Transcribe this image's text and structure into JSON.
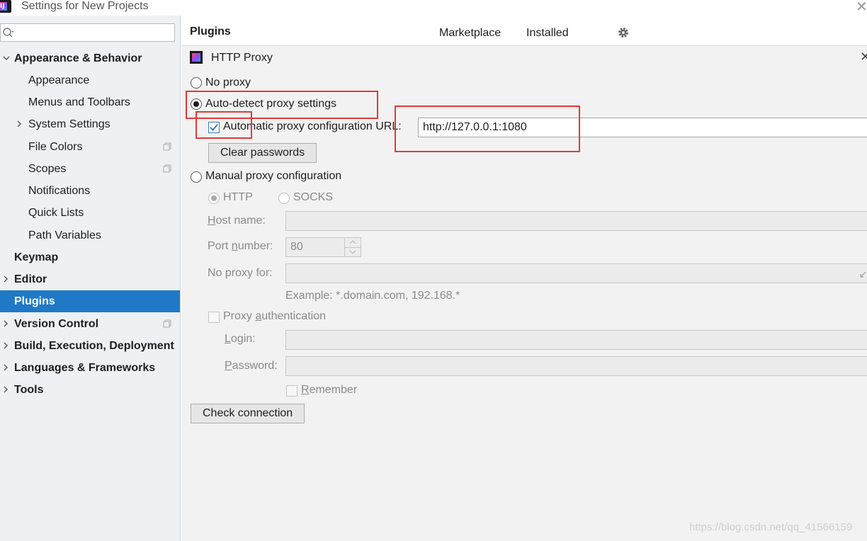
{
  "window": {
    "title": "Settings for New Projects",
    "app_icon_text": "IJ"
  },
  "search": {
    "placeholder": ""
  },
  "sidebar": {
    "items": [
      {
        "label": "Appearance & Behavior"
      },
      {
        "label": "Appearance"
      },
      {
        "label": "Menus and Toolbars"
      },
      {
        "label": "System Settings"
      },
      {
        "label": "File Colors"
      },
      {
        "label": "Scopes"
      },
      {
        "label": "Notifications"
      },
      {
        "label": "Quick Lists"
      },
      {
        "label": "Path Variables"
      },
      {
        "label": "Keymap"
      },
      {
        "label": "Editor"
      },
      {
        "label": "Plugins"
      },
      {
        "label": "Version Control"
      },
      {
        "label": "Build, Execution, Deployment"
      },
      {
        "label": "Languages & Frameworks"
      },
      {
        "label": "Tools"
      }
    ]
  },
  "header": {
    "title": "Plugins",
    "tabs": [
      "Marketplace",
      "Installed"
    ]
  },
  "dialog": {
    "title": "HTTP Proxy",
    "no_proxy": "No proxy",
    "auto_detect": "Auto-detect proxy settings",
    "auto_config_url_label": "Automatic proxy configuration URL:",
    "auto_config_url_value": "http://127.0.0.1:1080",
    "clear_passwords": "Clear passwords",
    "manual": "Manual proxy configuration",
    "http": "HTTP",
    "socks": "SOCKS",
    "host_label_first": "H",
    "host_label_rest": "ost name:",
    "port_label_pre": "Port ",
    "port_label_u": "n",
    "port_label_post": "umber:",
    "port_value": "80",
    "no_proxy_for": "No proxy for:",
    "example": "Example: *.domain.com, 192.168.*",
    "proxy_auth_pre": "Proxy ",
    "proxy_auth_u": "a",
    "proxy_auth_post": "uthentication",
    "login_u": "L",
    "login_rest": "ogin:",
    "password_u": "P",
    "password_rest": "assword:",
    "remember_u": "R",
    "remember_rest": "emember",
    "check_connection": "Check connection"
  },
  "watermark": "https://blog.csdn.net/qq_41566159",
  "colors": {
    "selection": "#1f79c6",
    "highlight": "#e03a3a",
    "sidebar_bg": "#eef0f4"
  }
}
